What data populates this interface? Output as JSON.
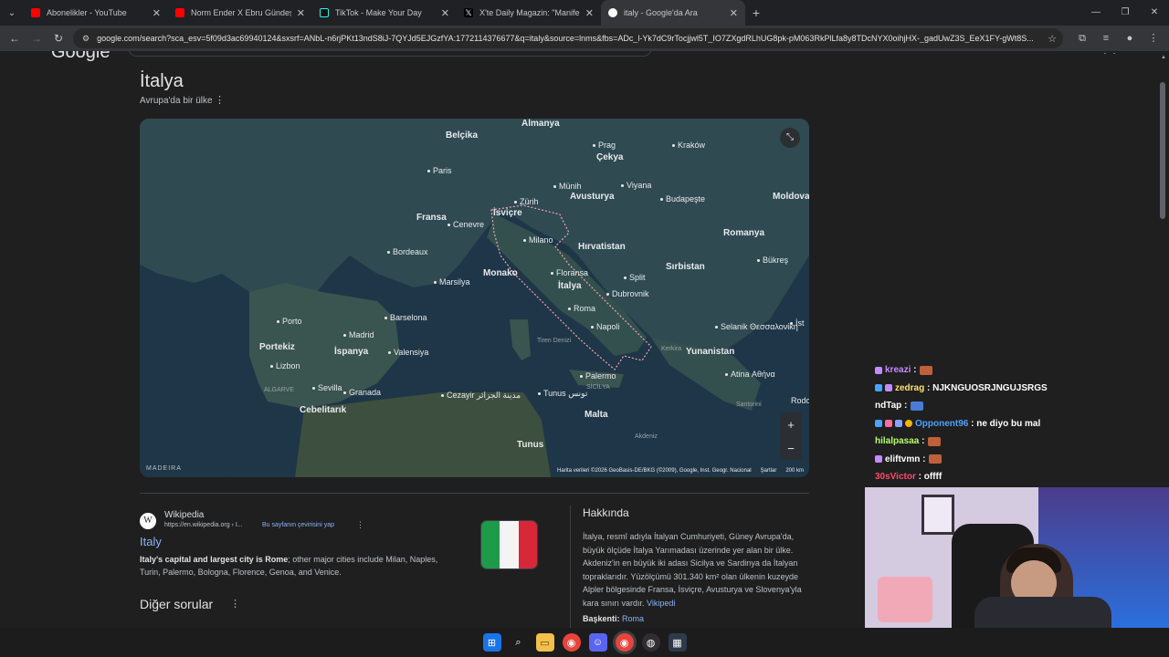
{
  "browser": {
    "tabs": [
      {
        "title": "Abonelikler - YouTube",
        "active": false
      },
      {
        "title": "Norm Ender X Ebru Gündeş - B",
        "active": false
      },
      {
        "title": "TikTok - Make Your Day",
        "active": false
      },
      {
        "title": "X'te Daily Magazin: \"Manifest o",
        "active": false
      },
      {
        "title": "italy - Google'da Ara",
        "active": true
      }
    ],
    "url": "google.com/search?sca_esv=5f09d3ac69940124&sxsrf=ANbL-n6rjPKt13ndS8iJ-7QYJd5EJGzfYA:1772114376677&q=italy&source=lnms&fbs=ADc_l-Yk7dC9rTocjjwl5T_IO7ZXgdRLhUG8pk-pM063RkPlLfa8y8TDcNYX0oihjHX-_gadUwZ3S_EeX1FY-gWt8S..."
  },
  "entity": {
    "title": "İtalya",
    "subtitle": "Avrupa'da bir ülke"
  },
  "map": {
    "labels": [
      {
        "text": "Almanya",
        "big": true,
        "dot": false
      },
      {
        "text": "Belçika",
        "big": true,
        "dot": false
      },
      {
        "text": "Prag",
        "big": false,
        "dot": true
      },
      {
        "text": "Çekya",
        "big": true,
        "dot": false
      },
      {
        "text": "Kraków",
        "big": false,
        "dot": true
      },
      {
        "text": "Paris",
        "big": false,
        "dot": true
      },
      {
        "text": "Münih",
        "big": false,
        "dot": true
      },
      {
        "text": "Viyana",
        "big": false,
        "dot": true
      },
      {
        "text": "Avusturya",
        "big": true,
        "dot": false
      },
      {
        "text": "Zürih",
        "big": false,
        "dot": true
      },
      {
        "text": "Budapeşte",
        "big": false,
        "dot": true
      },
      {
        "text": "Moldova",
        "big": true,
        "dot": false
      },
      {
        "text": "İsviçre",
        "big": true,
        "dot": false
      },
      {
        "text": "Fransa",
        "big": true,
        "dot": false
      },
      {
        "text": "Cenevre",
        "big": false,
        "dot": true
      },
      {
        "text": "Milano",
        "big": false,
        "dot": true
      },
      {
        "text": "Hırvatistan",
        "big": true,
        "dot": false
      },
      {
        "text": "Romanya",
        "big": true,
        "dot": false
      },
      {
        "text": "Bordeaux",
        "big": false,
        "dot": true
      },
      {
        "text": "Bükreş",
        "big": false,
        "dot": true
      },
      {
        "text": "Monako",
        "big": true,
        "dot": false
      },
      {
        "text": "Floransa",
        "big": false,
        "dot": true
      },
      {
        "text": "Sırbistan",
        "big": true,
        "dot": false
      },
      {
        "text": "Marsilya",
        "big": false,
        "dot": true
      },
      {
        "text": "Split",
        "big": false,
        "dot": true
      },
      {
        "text": "İtalya",
        "big": true,
        "dot": false
      },
      {
        "text": "Dubrovnik",
        "big": false,
        "dot": true
      },
      {
        "text": "Roma",
        "big": false,
        "dot": true
      },
      {
        "text": "Barselona",
        "big": false,
        "dot": true
      },
      {
        "text": "Porto",
        "big": false,
        "dot": true
      },
      {
        "text": "Madrid",
        "big": false,
        "dot": true
      },
      {
        "text": "Napoli",
        "big": false,
        "dot": true
      },
      {
        "text": "Selanik Θεσσαλονίκη",
        "big": false,
        "dot": true
      },
      {
        "text": "Portekiz",
        "big": true,
        "dot": false
      },
      {
        "text": "İspanya",
        "big": true,
        "dot": false
      },
      {
        "text": "Valensiya",
        "big": false,
        "dot": true
      },
      {
        "text": "Tiren Denizi",
        "big": false,
        "dot": false,
        "sea": true
      },
      {
        "text": "Yunanistan",
        "big": true,
        "dot": false
      },
      {
        "text": "Kerkira",
        "big": false,
        "dot": false,
        "sea": true
      },
      {
        "text": "Lizbon",
        "big": false,
        "dot": true
      },
      {
        "text": "Palermo",
        "big": false,
        "dot": true
      },
      {
        "text": "Atina Αθήνα",
        "big": false,
        "dot": true
      },
      {
        "text": "Sevilla",
        "big": false,
        "dot": true
      },
      {
        "text": "Granada",
        "big": false,
        "dot": true
      },
      {
        "text": "ALGARVE",
        "big": false,
        "dot": false,
        "sea": true
      },
      {
        "text": "SİCİLYA",
        "big": false,
        "dot": false,
        "sea": true
      },
      {
        "text": "Tunus تونس",
        "big": false,
        "dot": true
      },
      {
        "text": "Cezayir مدينة الجزائر",
        "big": false,
        "dot": true
      },
      {
        "text": "Cebelitarık",
        "big": true,
        "dot": false
      },
      {
        "text": "Malta",
        "big": true,
        "dot": false
      },
      {
        "text": "Santorini",
        "big": false,
        "dot": false,
        "sea": true
      },
      {
        "text": "Akdeniz",
        "big": false,
        "dot": false,
        "sea": true
      },
      {
        "text": "Tunus",
        "big": true,
        "dot": false
      },
      {
        "text": "Rodo",
        "big": false,
        "dot": false
      },
      {
        "text": "İst",
        "big": false,
        "dot": true
      }
    ],
    "madeira": "MADEIRA",
    "attribution": "Harita verileri ©2026 GeoBasis-DE/BKG (©2009), Google, Inst. Geogr. Nacional",
    "terms": "Şartlar",
    "scale": "200 km"
  },
  "wikipedia": {
    "site": "Wikipedia",
    "url": "https://en.wikipedia.org › I...",
    "translate": "Bu sayfanın çevirisini yap",
    "title": "Italy",
    "snippet_bold": "Italy's capital and largest city is Rome",
    "snippet_rest": "; other major cities include Milan, Naples, Turin, Palermo, Bologna, Florence, Genoa, and Venice."
  },
  "others": {
    "title": "Diğer sorular"
  },
  "about": {
    "title": "Hakkında",
    "text": "İtalya, resmî adıyla İtalyan Cumhuriyeti, Güney Avrupa'da, büyük ölçüde İtalya Yarımadası üzerinde yer alan bir ülke. Akdeniz'in en büyük iki adası Sicilya ve Sardinya da İtalyan topraklarıdır. Yüzölçümü 301.340 km² olan ülkenin kuzeyde Alpler bölgesinde Fransa, İsviçre, Avusturya ve Slovenya'yla kara sınırı vardır.",
    "source": "Vikipedi",
    "capital_label": "Başkenti:",
    "capital_value": "Roma"
  },
  "chat": [
    {
      "user": "kreazi",
      "message": "",
      "color": "#c58aff"
    },
    {
      "user": "zedrag",
      "message": "NJKNGUOSRJNGUJSRGS",
      "color": "#ffe36b"
    },
    {
      "user": "ndTap",
      "message": "",
      "color": "#ffffff"
    },
    {
      "user": "Opponent96",
      "message": "ne diyo bu mal",
      "color": "#4aa3ff"
    },
    {
      "user": "hilalpasaa",
      "message": "",
      "color": "#b5ff6b"
    },
    {
      "user": "eliftvmn",
      "message": "",
      "color": "#ffffff"
    },
    {
      "user": "30sVictor",
      "message": "offff",
      "color": "#ff4a6b"
    }
  ],
  "taskbar": {
    "icons": [
      "windows-start",
      "search",
      "file-explorer",
      "chrome",
      "discord",
      "chrome-active",
      "obs",
      "calculator"
    ]
  }
}
